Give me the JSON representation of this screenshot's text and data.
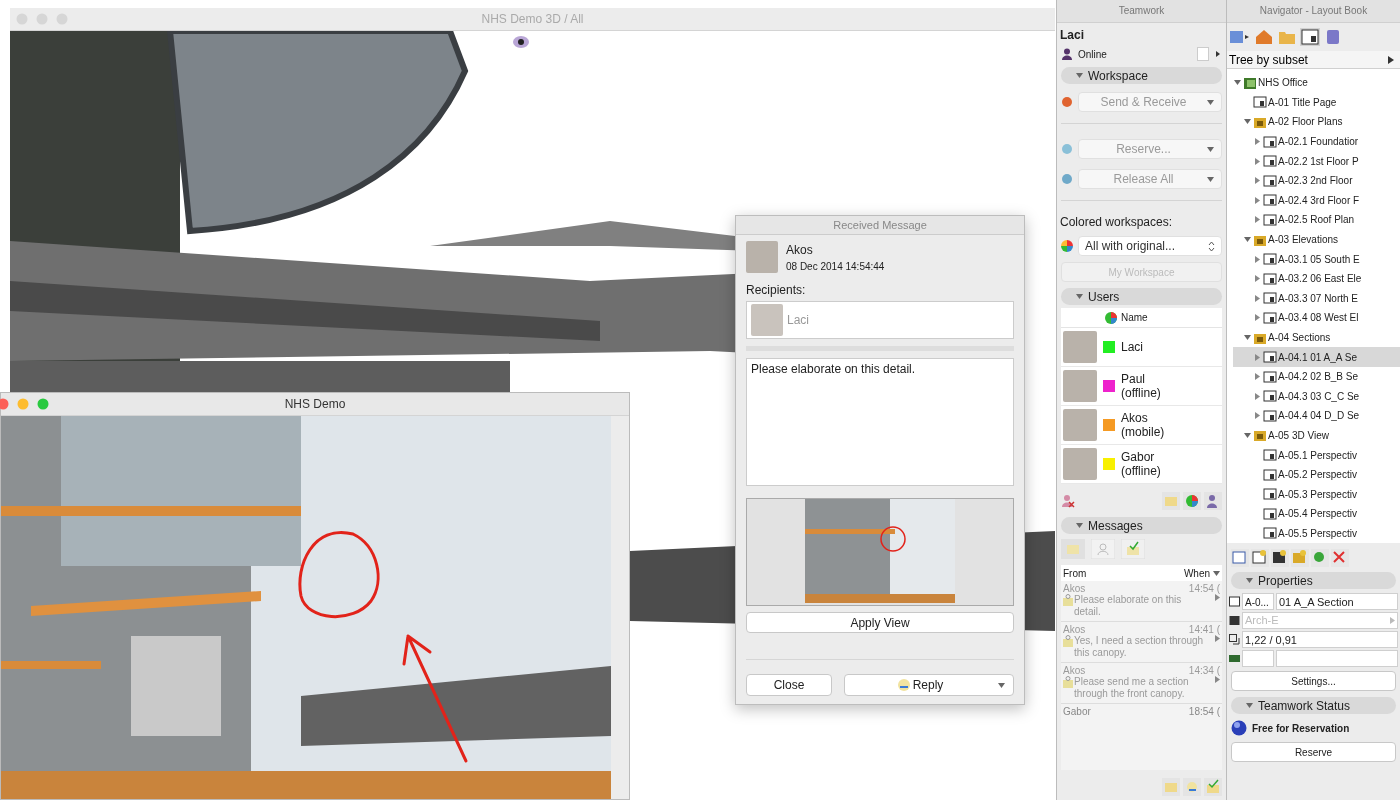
{
  "main_window": {
    "title": "NHS Demo 3D / All"
  },
  "sub_window": {
    "title": "NHS Demo"
  },
  "message_dialog": {
    "title": "Received Message",
    "sender": "Akos",
    "date": "08 Dec 2014 14:54:44",
    "recipients_label": "Recipients:",
    "recipients": [
      "Laci"
    ],
    "body": "Please elaborate on this detail.",
    "apply_button": "Apply View",
    "close_button": "Close",
    "reply_button": "Reply"
  },
  "teamwork": {
    "title": "Teamwork",
    "user": "Laci",
    "status": "Online",
    "workspace_header": "Workspace",
    "send_receive": "Send & Receive",
    "reserve": "Reserve...",
    "release_all": "Release All",
    "colored_label": "Colored workspaces:",
    "colored_value": "All with original...",
    "my_workspace": "My Workspace",
    "users_header": "Users",
    "users_column": "Name",
    "users": [
      {
        "name": "Laci",
        "color": "#22ee22"
      },
      {
        "name": "Paul",
        "status": "(offline)",
        "color": "#ee22cc"
      },
      {
        "name": "Akos",
        "status": "(mobile)",
        "color": "#f59a23"
      },
      {
        "name": "Gabor",
        "status": "(offline)",
        "color": "#f8f000"
      }
    ],
    "messages_header": "Messages",
    "from_column": "From",
    "when_column": "When",
    "messages": [
      {
        "from": "Akos",
        "when": "14:54 (",
        "text": "Please elaborate on this detail."
      },
      {
        "from": "Akos",
        "when": "14:41 (",
        "text": "Yes, I need a section through this canopy."
      },
      {
        "from": "Akos",
        "when": "14:34 (",
        "text": "Please send me a section through the front canopy."
      },
      {
        "from": "Gabor",
        "when": "18:54 ("
      }
    ]
  },
  "navigator": {
    "title": "Navigator - Layout Book",
    "view_mode": "Tree by subset",
    "tree": [
      {
        "label": "NHS Office",
        "kind": "book",
        "expanded": true,
        "selected": false,
        "children": [
          {
            "label": "A-01 Title Page",
            "kind": "layout",
            "selected": false
          },
          {
            "label": "A-02 Floor Plans",
            "kind": "subset",
            "expanded": true,
            "selected": false,
            "children": [
              {
                "label": "A-02.1 Foundatior",
                "kind": "layout",
                "expanded": false,
                "selected": false
              },
              {
                "label": "A-02.2 1st Floor P",
                "kind": "layout",
                "expanded": false,
                "selected": false
              },
              {
                "label": "A-02.3 2nd Floor",
                "kind": "layout",
                "expanded": false,
                "selected": false
              },
              {
                "label": "A-02.4 3rd Floor F",
                "kind": "layout",
                "expanded": false,
                "selected": false
              },
              {
                "label": "A-02.5 Roof Plan",
                "kind": "layout",
                "expanded": false,
                "selected": false
              }
            ]
          },
          {
            "label": "A-03 Elevations",
            "kind": "subset",
            "expanded": true,
            "selected": false,
            "children": [
              {
                "label": "A-03.1 05 South E",
                "kind": "layout",
                "expanded": false,
                "selected": false
              },
              {
                "label": "A-03.2 06 East Ele",
                "kind": "layout",
                "expanded": false,
                "selected": false
              },
              {
                "label": "A-03.3 07 North E",
                "kind": "layout",
                "expanded": false,
                "selected": false
              },
              {
                "label": "A-03.4 08 West El",
                "kind": "layout",
                "expanded": false,
                "selected": false
              }
            ]
          },
          {
            "label": "A-04 Sections",
            "kind": "subset",
            "expanded": true,
            "selected": false,
            "children": [
              {
                "label": "A-04.1 01 A_A Se",
                "kind": "layout",
                "expanded": false,
                "selected": true
              },
              {
                "label": "A-04.2 02 B_B Se",
                "kind": "layout",
                "expanded": false,
                "selected": false
              },
              {
                "label": "A-04.3 03 C_C Se",
                "kind": "layout",
                "expanded": false,
                "selected": false
              },
              {
                "label": "A-04.4 04 D_D Se",
                "kind": "layout",
                "expanded": false,
                "selected": false
              }
            ]
          },
          {
            "label": "A-05 3D View",
            "kind": "subset",
            "expanded": true,
            "selected": false,
            "children": [
              {
                "label": "A-05.1 Perspectiv",
                "kind": "layout",
                "selected": false
              },
              {
                "label": "A-05.2 Perspectiv",
                "kind": "layout",
                "selected": false
              },
              {
                "label": "A-05.3 Perspectiv",
                "kind": "layout",
                "selected": false
              },
              {
                "label": "A-05.4 Perspectiv",
                "kind": "layout",
                "selected": false
              },
              {
                "label": "A-05.5 Perspectiv",
                "kind": "layout",
                "selected": false
              }
            ]
          }
        ]
      }
    ],
    "properties_header": "Properties",
    "layout_id": "A-0...",
    "layout_name": "01 A_A Section",
    "master": "Arch-E",
    "size": "1,22 / 0,91",
    "settings_button": "Settings...",
    "status_header": "Teamwork Status",
    "reservation_status": "Free for Reservation",
    "reserve_button": "Reserve"
  }
}
